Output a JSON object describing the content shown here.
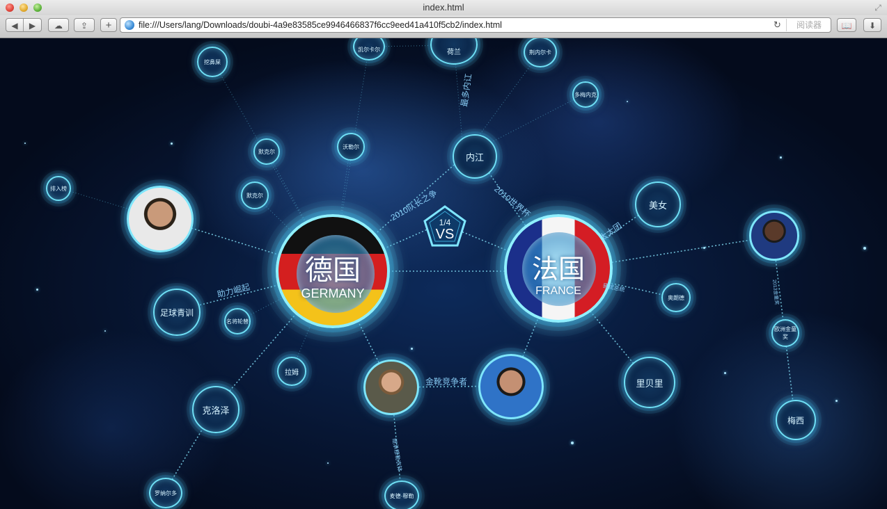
{
  "window": {
    "title": "index.html"
  },
  "toolbar": {
    "url": "file:///Users/lang/Downloads/doubi-4a9e83585ce9946466837f6cc9eed41a410f5cb2/index.html",
    "reader_label": "阅读器",
    "add_label": "+",
    "icons": [
      "back-icon",
      "forward-icon",
      "cloud-icon",
      "share-icon",
      "reload-icon",
      "bookmarks-icon",
      "downloads-icon"
    ]
  },
  "match": {
    "stage": "1/4",
    "vs": "VS",
    "team_a": {
      "cn": "德国",
      "en": "GERMANY"
    },
    "team_b": {
      "cn": "法国",
      "en": "FRANCE"
    }
  },
  "nodes": {
    "wajue": "挖鼻屎",
    "helan": "荷兰",
    "jianei": "荆内尔卡",
    "duomei": "多梅内克",
    "neijiang": "内江",
    "meinv": "美女",
    "yingbu": "排入榜",
    "xiaoren": "默克尔",
    "mokeer": "默克尔",
    "kaier": "沃勒尔",
    "zuqiu": "足球青训",
    "mingren": "名将轮替",
    "lamu": "拉姆",
    "keluoze": "克洛泽",
    "luonaerduo": "罗纳尔多",
    "ao": "奥朗德",
    "libeili": "里贝里",
    "oufan": "欧洲金童奖",
    "meixi": "梅西",
    "mule": "麦德·穆勒",
    "kaer": "凯尔卡尔",
    "jiemi": "默克尔"
  },
  "edge_labels": {
    "duiz": "2010队长之争",
    "neijiang_edge": "最多内讧",
    "shijiebei": "2010世界杯",
    "taitai": "太太团",
    "zhuli": "助力崛起",
    "jinxue": "金靴竞争者",
    "jiren": "继承穆勒衣钵",
    "ao_edge": "骚扰总统",
    "meixi_edge": "2013金童奖"
  }
}
